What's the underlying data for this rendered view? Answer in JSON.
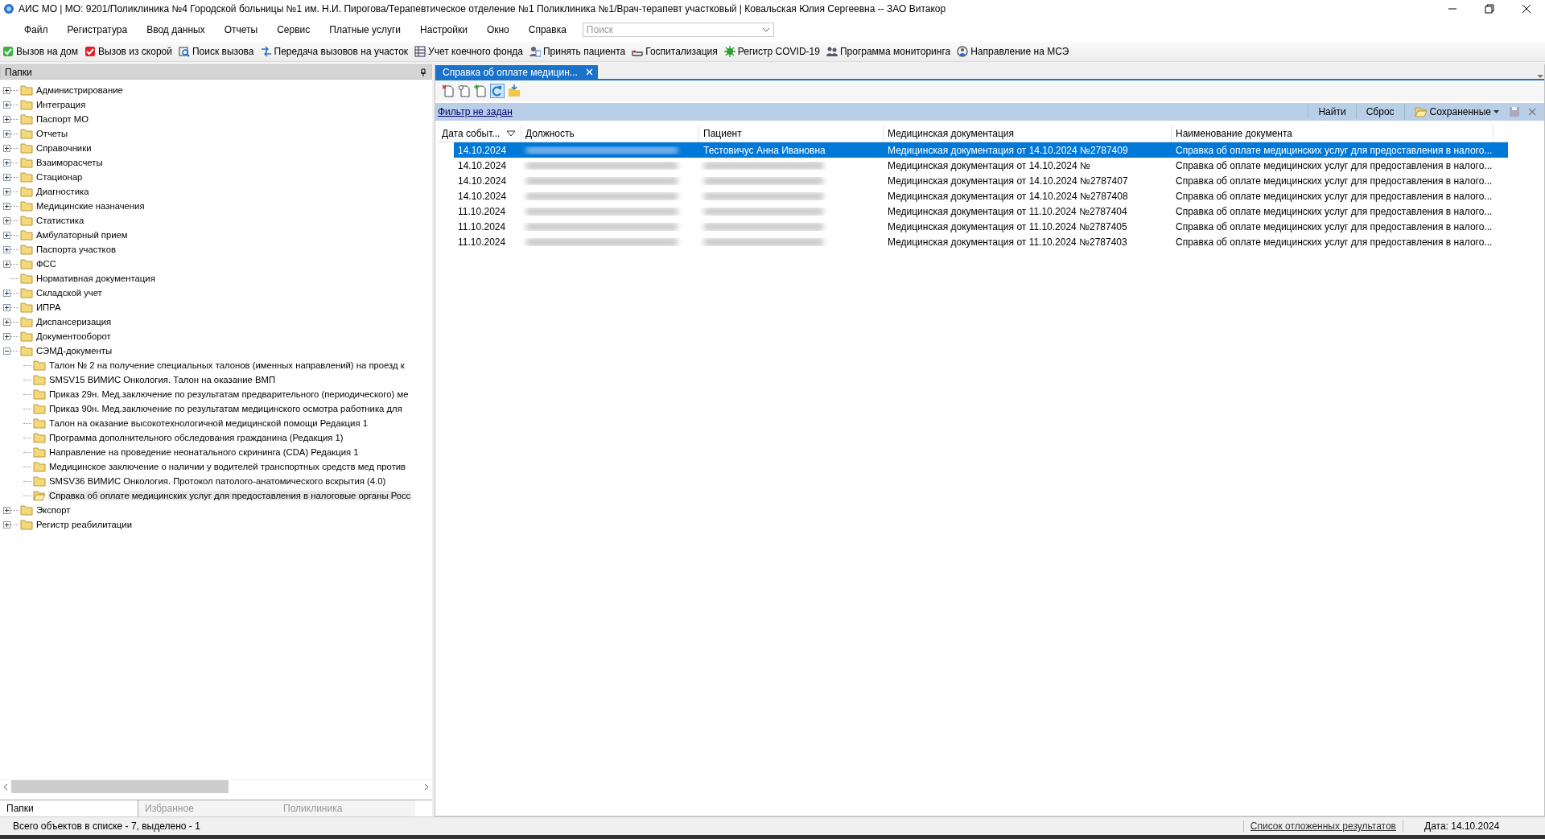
{
  "window": {
    "title": "АИС МО | МО: 9201/Поликлиника №4 Городской больницы №1 им. Н.И. Пирогова/Терапевтическое отделение №1 Поликлиника №1/Врач-терапевт участковый | Ковальская Юлия Сергеевна -- ЗАО Витакор"
  },
  "menu": [
    "Файл",
    "Регистратура",
    "Ввод данных",
    "Отчеты",
    "Сервис",
    "Платные услуги",
    "Настройки",
    "Окно",
    "Справка"
  ],
  "search": {
    "placeholder": "Поиск"
  },
  "toolbar": [
    "Вызов на дом",
    "Вызов из скорой",
    "Поиск вызова",
    "Передача вызовов на участок",
    "Учет коечного фонда",
    "Принять пациента",
    "Госпитализация",
    "Регистр COVID-19",
    "Программа мониторинга",
    "Направление на МСЭ"
  ],
  "folders_panel": {
    "title": "Папки",
    "tree": [
      {
        "label": "Администрирование",
        "expandable": true,
        "expanded": false,
        "selected": false
      },
      {
        "label": "Интеграция",
        "expandable": true,
        "expanded": false,
        "selected": false
      },
      {
        "label": "Паспорт МО",
        "expandable": true,
        "expanded": false,
        "selected": false
      },
      {
        "label": "Отчеты",
        "expandable": true,
        "expanded": false,
        "selected": false
      },
      {
        "label": "Справочники",
        "expandable": true,
        "expanded": false,
        "selected": false
      },
      {
        "label": "Взаиморасчеты",
        "expandable": true,
        "expanded": false,
        "selected": false
      },
      {
        "label": "Стационар",
        "expandable": true,
        "expanded": false,
        "selected": false
      },
      {
        "label": "Диагностика",
        "expandable": true,
        "expanded": false,
        "selected": false
      },
      {
        "label": "Медицинские назначения",
        "expandable": true,
        "expanded": false,
        "selected": false
      },
      {
        "label": "Статистика",
        "expandable": true,
        "expanded": false,
        "selected": false
      },
      {
        "label": "Амбулаторный прием",
        "expandable": true,
        "expanded": false,
        "selected": false
      },
      {
        "label": "Паспорта участков",
        "expandable": true,
        "expanded": false,
        "selected": false
      },
      {
        "label": "ФСС",
        "expandable": true,
        "expanded": false,
        "selected": false
      },
      {
        "label": "Нормативная документация",
        "expandable": false,
        "selected": false
      },
      {
        "label": "Складской учет",
        "expandable": true,
        "expanded": false,
        "selected": false
      },
      {
        "label": "ИПРА",
        "expandable": true,
        "expanded": false,
        "selected": false
      },
      {
        "label": "Диспансеризация",
        "expandable": true,
        "expanded": false,
        "selected": false
      },
      {
        "label": "Документооборот",
        "expandable": true,
        "expanded": false,
        "selected": false
      },
      {
        "label": "СЭМД-документы",
        "expandable": true,
        "expanded": true,
        "selected": false,
        "children": [
          {
            "label": "Талон № 2 на получение специальных талонов (именных направлений) на проезд к",
            "selected": false
          },
          {
            "label": "SMSV15 ВИМИС Онкология. Талон на оказание ВМП",
            "selected": false
          },
          {
            "label": "Приказ 29н. Мед.заключение по результатам предварительного (периодического) ме",
            "selected": false
          },
          {
            "label": "Приказ 90н. Мед.заключение по результатам медицинского осмотра работника для",
            "selected": false
          },
          {
            "label": "Талон на оказание высокотехнологичной медицинской помощи Редакция 1",
            "selected": false
          },
          {
            "label": "Программа дополнительного обследования гражданина (Редакция 1)",
            "selected": false
          },
          {
            "label": "Направление на проведение неонатального скрининга (CDA) Редакция 1",
            "selected": false
          },
          {
            "label": "Медицинское заключение о наличии у водителей транспортных средств мед против",
            "selected": false
          },
          {
            "label": "SMSV36 ВИМИС Онкология. Протокол патолого-анатомического вскрытия (4.0)",
            "selected": false
          },
          {
            "label": "Справка об оплате медицинских услуг для предоставления в налоговые органы Росс",
            "selected": true
          }
        ]
      },
      {
        "label": "Экспорт",
        "expandable": true,
        "expanded": false,
        "selected": false
      },
      {
        "label": "Регистр реабилитации",
        "expandable": true,
        "expanded": false,
        "selected": false
      }
    ]
  },
  "bottom_tabs": [
    {
      "label": "Папки",
      "selected": true
    },
    {
      "label": "Избранное",
      "selected": false
    },
    {
      "label": "Поликлиника",
      "selected": false
    }
  ],
  "document_tab": {
    "label": "Справка об оплате медицин..."
  },
  "filter": {
    "link": "Фильтр не задан",
    "buttons": [
      "Найти",
      "Сброс",
      "Сохраненные"
    ]
  },
  "table": {
    "columns": [
      {
        "label": "Дата событ...",
        "sorted": true
      },
      {
        "label": "Должность",
        "sorted": false
      },
      {
        "label": "Пациент",
        "sorted": false
      },
      {
        "label": "Медицинская документация",
        "sorted": false
      },
      {
        "label": "Наименование документа",
        "sorted": false
      }
    ],
    "rows": [
      {
        "selected": true,
        "cells": [
          {
            "text": "14.10.2024",
            "redacted": false
          },
          {
            "redacted": true
          },
          {
            "text": "Тестовичус Анна Ивановна",
            "redacted": false
          },
          {
            "text": "Медицинская документация от 14.10.2024 №2787409",
            "redacted": false
          },
          {
            "text": "Справка об оплате медицинских услуг для предоставления в налого...",
            "redacted": false
          }
        ]
      },
      {
        "selected": false,
        "cells": [
          {
            "text": "14.10.2024",
            "redacted": false
          },
          {
            "redacted": true
          },
          {
            "redacted": true
          },
          {
            "text": "Медицинская документация от 14.10.2024 №",
            "redacted": false
          },
          {
            "text": "Справка об оплате медицинских услуг для предоставления в налого...",
            "redacted": false
          }
        ]
      },
      {
        "selected": false,
        "cells": [
          {
            "text": "14.10.2024",
            "redacted": false
          },
          {
            "redacted": true
          },
          {
            "redacted": true
          },
          {
            "text": "Медицинская документация от 14.10.2024 №2787407",
            "redacted": false
          },
          {
            "text": "Справка об оплате медицинских услуг для предоставления в налого...",
            "redacted": false
          }
        ]
      },
      {
        "selected": false,
        "cells": [
          {
            "text": "14.10.2024",
            "redacted": false
          },
          {
            "redacted": true
          },
          {
            "redacted": true
          },
          {
            "text": "Медицинская документация от 14.10.2024 №2787408",
            "redacted": false
          },
          {
            "text": "Справка об оплате медицинских услуг для предоставления в налого...",
            "redacted": false
          }
        ]
      },
      {
        "selected": false,
        "cells": [
          {
            "text": "11.10.2024",
            "redacted": false
          },
          {
            "redacted": true
          },
          {
            "redacted": true
          },
          {
            "text": "Медицинская документация от 11.10.2024 №2787404",
            "redacted": false
          },
          {
            "text": "Справка об оплате медицинских услуг для предоставления в налого...",
            "redacted": false
          }
        ]
      },
      {
        "selected": false,
        "cells": [
          {
            "text": "11.10.2024",
            "redacted": false
          },
          {
            "redacted": true
          },
          {
            "redacted": true
          },
          {
            "text": "Медицинская документация от 11.10.2024 №2787405",
            "redacted": false
          },
          {
            "text": "Справка об оплате медицинских услуг для предоставления в налого...",
            "redacted": false
          }
        ]
      },
      {
        "selected": false,
        "cells": [
          {
            "text": "11.10.2024",
            "redacted": false
          },
          {
            "redacted": true
          },
          {
            "redacted": true
          },
          {
            "text": "Медицинская документация от 11.10.2024 №2787403",
            "redacted": false
          },
          {
            "text": "Справка об оплате медицинских услуг для предоставления в налого...",
            "redacted": false
          }
        ]
      }
    ]
  },
  "status_bar": {
    "text": "Всего объектов в списке - 7, выделено - 1",
    "link": "Список отложенных результатов",
    "date": "Дата: 14.10.2024"
  }
}
